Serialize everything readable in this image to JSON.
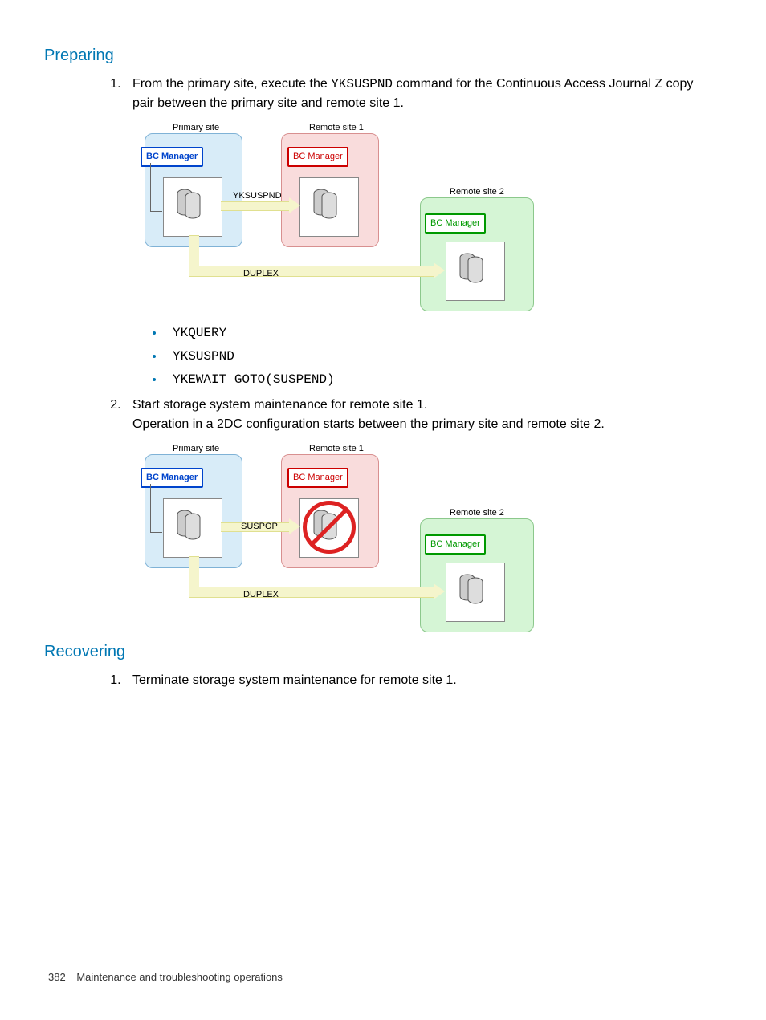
{
  "sections": {
    "preparing": {
      "heading": "Preparing",
      "steps": [
        {
          "n": "1.",
          "text_before": "From the primary site, execute the ",
          "code": "YKSUSPND",
          "text_after": " command for the Continuous Access Journal Z copy pair between the primary site and remote site 1.",
          "bullets": [
            "YKQUERY",
            "YKSUSPND",
            "YKEWAIT GOTO(SUSPEND)"
          ]
        },
        {
          "n": "2.",
          "line1": "Start storage system maintenance for remote site 1.",
          "line2": "Operation in a 2DC configuration starts between the primary site and remote site 2."
        }
      ]
    },
    "recovering": {
      "heading": "Recovering",
      "steps": [
        {
          "n": "1.",
          "line1": "Terminate storage system maintenance for remote site 1."
        }
      ]
    }
  },
  "diagram": {
    "primary_label": "Primary site",
    "remote1_label": "Remote site 1",
    "remote2_label": "Remote site 2",
    "bc_manager": "BC Manager",
    "op1": "YKSUSPND",
    "op2": "SUSPOP",
    "duplex": "DUPLEX"
  },
  "footer": {
    "page": "382",
    "title": "Maintenance and troubleshooting operations"
  }
}
